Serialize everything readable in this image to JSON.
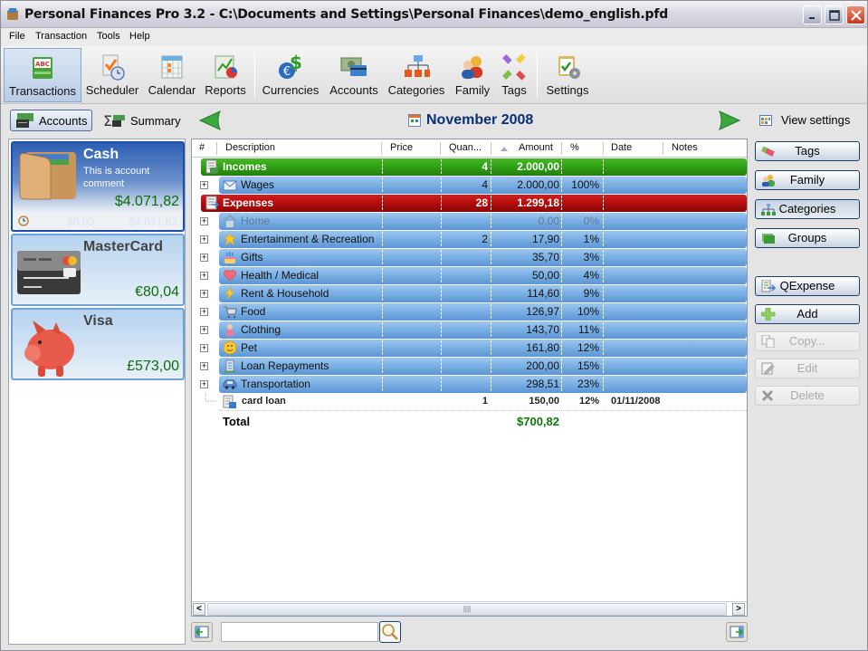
{
  "window": {
    "title": "Personal Finances Pro 3.2 - C:\\Documents and Settings\\Personal Finances\\demo_english.pfd"
  },
  "menu": [
    "File",
    "Transaction",
    "Tools",
    "Help"
  ],
  "toolbar": {
    "items": [
      {
        "label": "Transactions",
        "icon": "transactions-icon",
        "active": true
      },
      {
        "label": "Scheduler",
        "icon": "scheduler-icon"
      },
      {
        "label": "Calendar",
        "icon": "calendar-icon"
      },
      {
        "label": "Reports",
        "icon": "reports-icon"
      },
      {
        "label": "Currencies",
        "icon": "currencies-icon"
      },
      {
        "label": "Accounts",
        "icon": "accounts-icon"
      },
      {
        "label": "Categories",
        "icon": "categories-icon"
      },
      {
        "label": "Family",
        "icon": "family-icon"
      },
      {
        "label": "Tags",
        "icon": "tags-icon"
      },
      {
        "label": "Settings",
        "icon": "settings-icon"
      }
    ]
  },
  "nav": {
    "accounts_tab": "Accounts",
    "summary_tab": "Summary",
    "month": "November 2008",
    "view_settings": "View settings"
  },
  "accounts": [
    {
      "name": "Cash",
      "comment": "This is account comment",
      "balance": "$4.071,82",
      "ghost_left": "$0,00",
      "ghost_right": "$4.071,82",
      "selected": true
    },
    {
      "name": "MasterCard",
      "balance": "€80,04"
    },
    {
      "name": "Visa",
      "balance": "£573,00"
    }
  ],
  "grid": {
    "columns": [
      "#",
      "Description",
      "Price",
      "Quan...",
      "Amount",
      "%",
      "Date",
      "Notes"
    ],
    "groups": [
      {
        "label": "Incomes",
        "qty": "4",
        "amount": "2.000,00",
        "color": "#2e9d13"
      },
      {
        "label": "Expenses",
        "qty": "28",
        "amount": "1.299,18",
        "color": "#b00c0c"
      }
    ],
    "income_rows": [
      {
        "label": "Wages",
        "qty": "4",
        "amount": "2.000,00",
        "pct": "100%"
      }
    ],
    "expense_rows": [
      {
        "label": "Home",
        "qty": "",
        "amount": "0,00",
        "pct": "0%"
      },
      {
        "label": "Entertainment & Recreation",
        "qty": "2",
        "amount": "17,90",
        "pct": "1%"
      },
      {
        "label": "Gifts",
        "qty": "",
        "amount": "35,70",
        "pct": "3%"
      },
      {
        "label": "Health / Medical",
        "qty": "",
        "amount": "50,00",
        "pct": "4%"
      },
      {
        "label": "Rent & Household",
        "qty": "",
        "amount": "114,60",
        "pct": "9%"
      },
      {
        "label": "Food",
        "qty": "",
        "amount": "126,97",
        "pct": "10%"
      },
      {
        "label": "Clothing",
        "qty": "",
        "amount": "143,70",
        "pct": "11%"
      },
      {
        "label": "Pet",
        "qty": "",
        "amount": "161,80",
        "pct": "12%"
      },
      {
        "label": "Loan Repayments",
        "qty": "",
        "amount": "200,00",
        "pct": "15%"
      },
      {
        "label": "Transportation",
        "qty": "",
        "amount": "298,51",
        "pct": "23%"
      }
    ],
    "transaction": {
      "label": "card loan",
      "qty": "1",
      "amount": "150,00",
      "pct": "12%",
      "date": "01/11/2008"
    },
    "total": {
      "label": "Total",
      "amount": "$700,82"
    }
  },
  "side_buttons": {
    "tags": "Tags",
    "family": "Family",
    "categories": "Categories",
    "groups": "Groups",
    "qexpense": "QExpense",
    "add": "Add",
    "copy": "Copy...",
    "edit": "Edit",
    "delete": "Delete"
  },
  "search": {
    "value": "",
    "placeholder": ""
  }
}
